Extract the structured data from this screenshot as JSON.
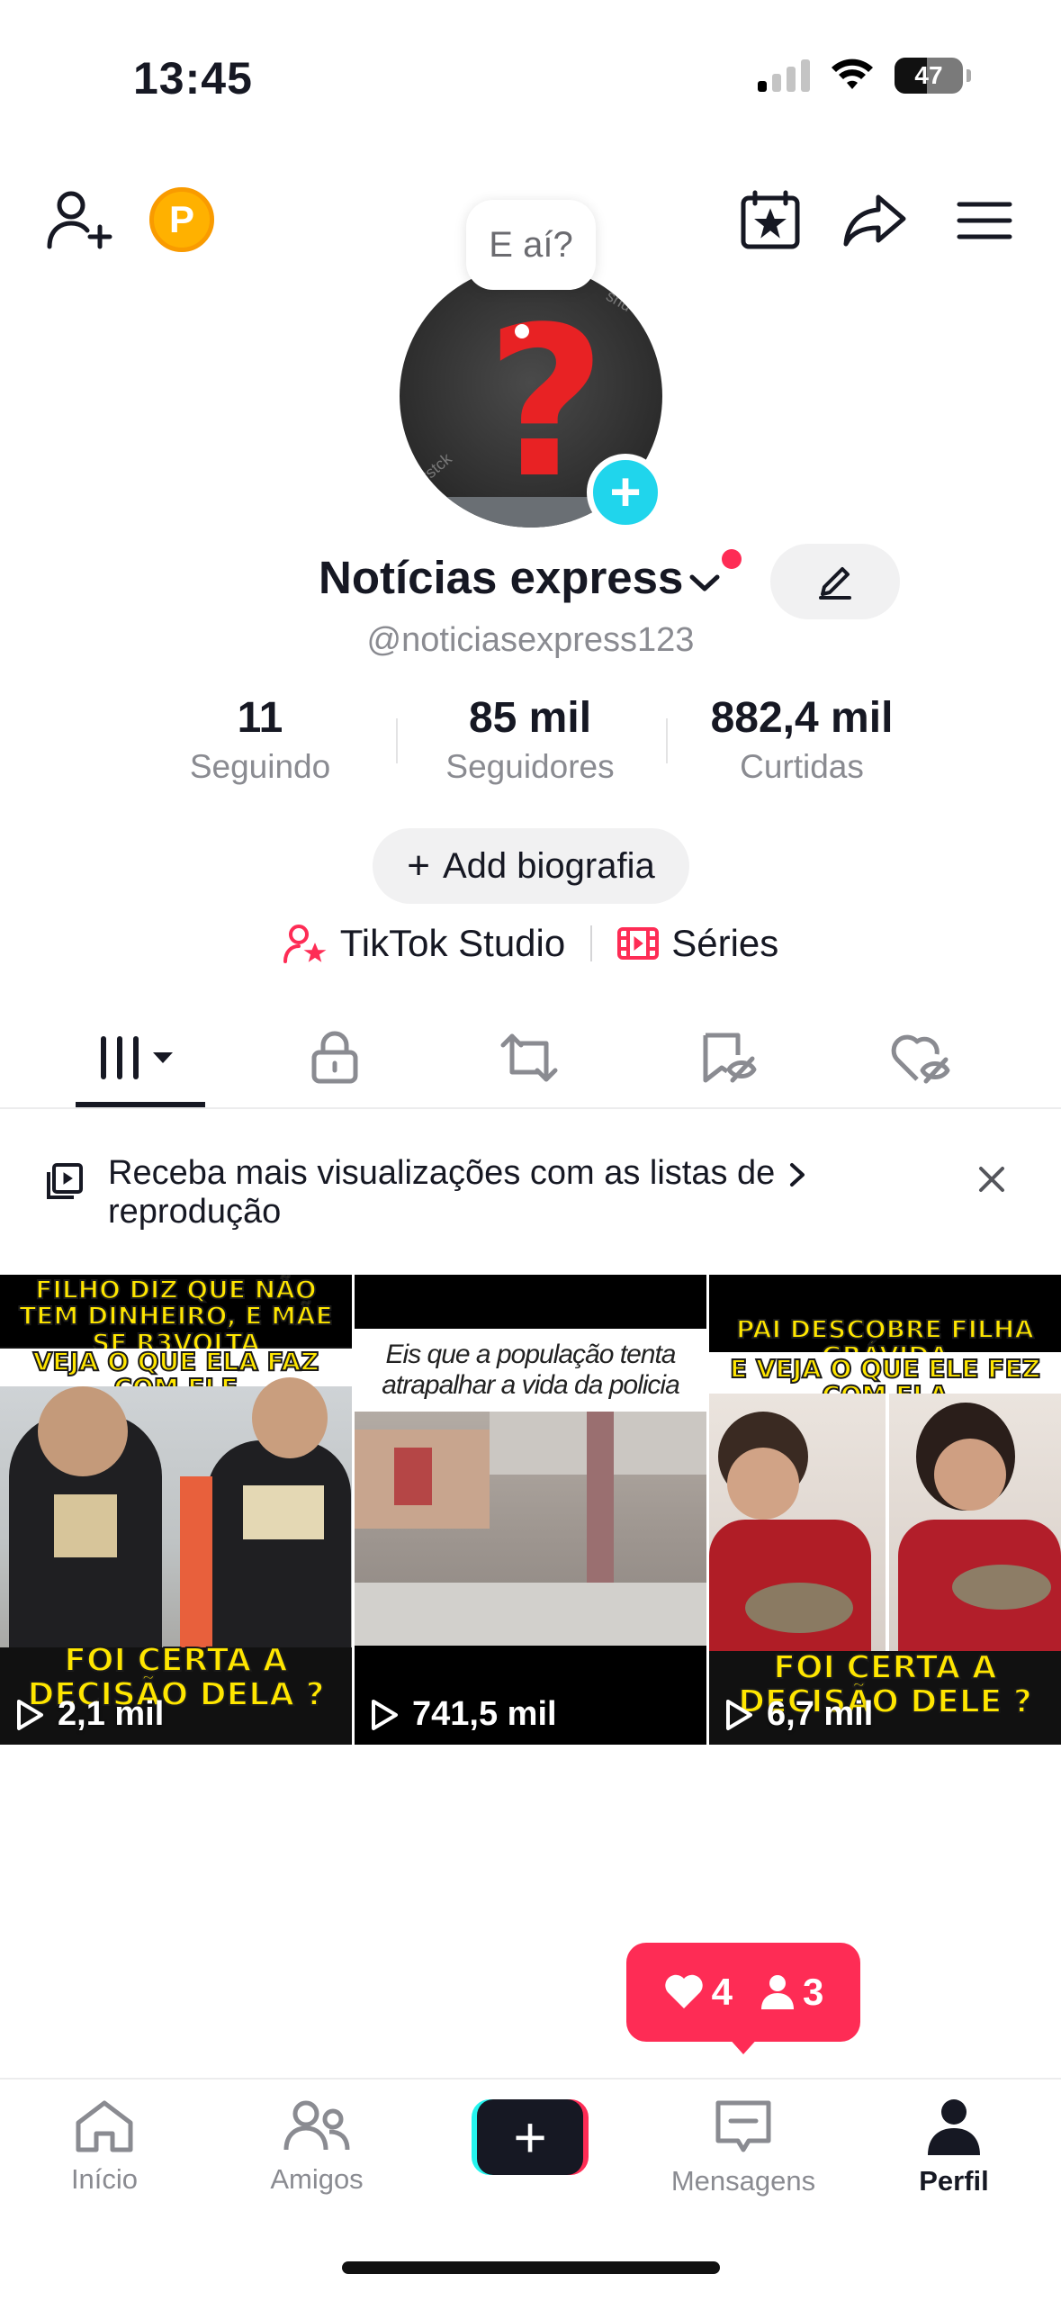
{
  "status_bar": {
    "time": "13:45",
    "battery": "47"
  },
  "top_bar": {
    "coin_label": "P"
  },
  "profile": {
    "bubble_text": "E aí?",
    "name": "Notícias express",
    "handle": "@noticiasexpress123",
    "avatar_watermark": [
      "shu",
      "rstck"
    ]
  },
  "stats": [
    {
      "value": "11",
      "label": "Seguindo"
    },
    {
      "value": "85 mil",
      "label": "Seguidores"
    },
    {
      "value": "882,4 mil",
      "label": "Curtidas"
    }
  ],
  "bio_button": {
    "label": "Add biografia"
  },
  "links": {
    "studio": "TikTok Studio",
    "series": "Séries"
  },
  "banner": {
    "text": "Receba mais visualizações com as listas de reprodução"
  },
  "videos": [
    {
      "caption_top": "FILHO DIZ QUE NÃO TEM DINHEIRO, E MÃE SE R3VOLTA",
      "caption_mid": "VEJA O QUE ELA FAZ COM ELE",
      "caption_bottom": "FOI CERTA A DECISÃO DELA ?",
      "views": "2,1 mil"
    },
    {
      "caption_top": "Eis que a população tenta atrapalhar a vida da policia",
      "views": "741,5 mil"
    },
    {
      "caption_top": "PAI DESCOBRE FILHA GRÁVIDA",
      "caption_mid": "E VEJA O QUE ELE FEZ COM ELA",
      "caption_bottom": "FOI CERTA A DECISÃO DELE ?",
      "views": "6,7 mil"
    }
  ],
  "notifications": {
    "likes": "4",
    "followers": "3"
  },
  "bottom_nav": [
    {
      "label": "Início",
      "icon": "home-icon"
    },
    {
      "label": "Amigos",
      "icon": "friends-icon"
    },
    {
      "label": "Mensagens",
      "icon": "messages-icon"
    },
    {
      "label": "Perfil",
      "icon": "profile-icon"
    }
  ],
  "colors": {
    "accent": "#fe2c55",
    "cyan": "#25f4ee",
    "text": "#161823",
    "muted": "#8a8b91"
  }
}
